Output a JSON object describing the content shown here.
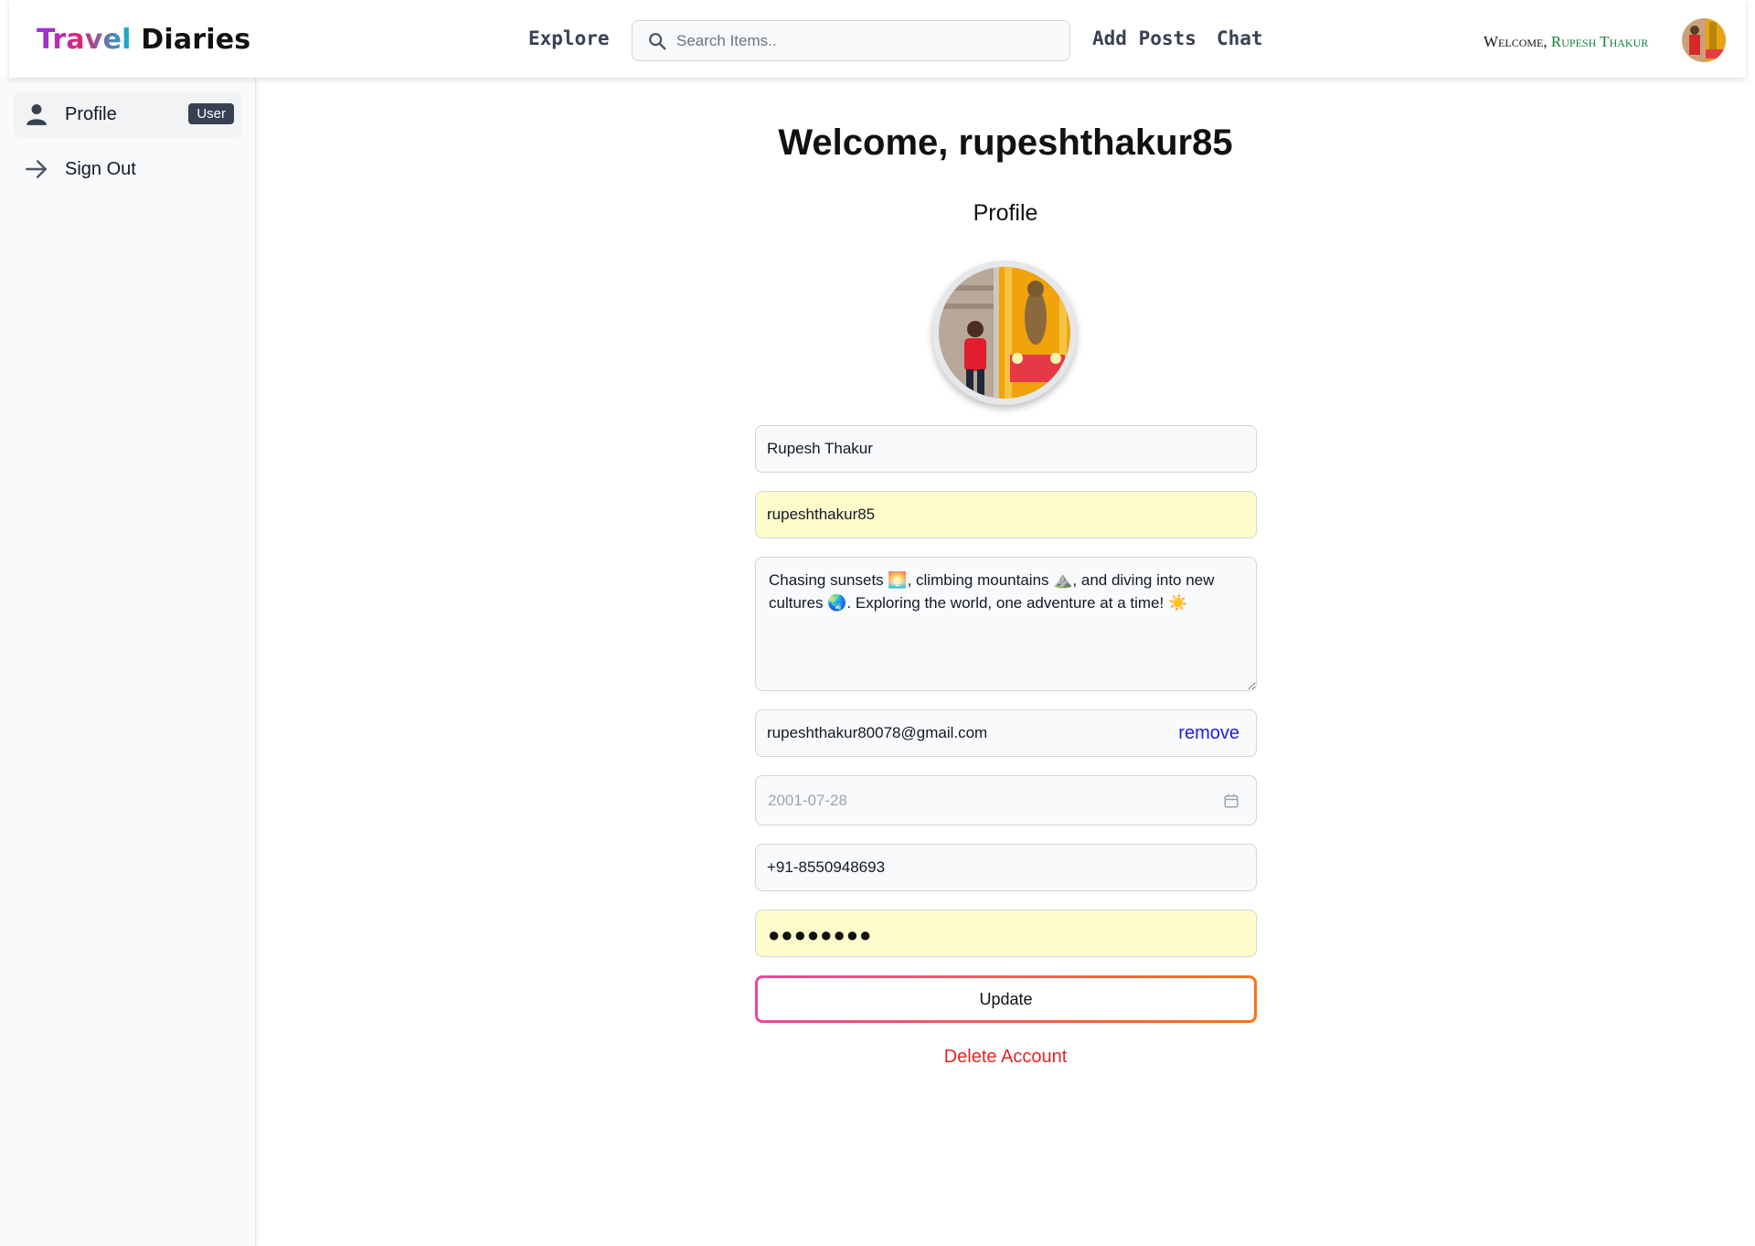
{
  "header": {
    "logo_part1": "Travel",
    "logo_part2": "Diaries",
    "nav_explore": "Explore",
    "search_placeholder": "Search Items..",
    "nav_add_posts": "Add Posts",
    "nav_chat": "Chat",
    "welcome_prefix": "Welcome,",
    "welcome_name": "Rupesh Thakur"
  },
  "sidebar": {
    "items": [
      {
        "label": "Profile",
        "badge": "User",
        "icon": "user-icon"
      },
      {
        "label": "Sign Out",
        "icon": "arrow-right-icon"
      }
    ]
  },
  "main": {
    "title": "Welcome, rupeshthakur85",
    "subtitle": "Profile",
    "fields": {
      "full_name": "Rupesh Thakur",
      "username": "rupeshthakur85",
      "bio": "Chasing sunsets 🌅, climbing mountains ⛰️, and diving into new cultures 🌏. Exploring the world, one adventure at a time! ☀️",
      "email": "rupeshthakur80078@gmail.com",
      "email_action": "remove",
      "dob": "2001-07-28",
      "phone": "+91-8550948693",
      "password_mask": "●●●●●●●●"
    },
    "update_label": "Update",
    "delete_label": "Delete Account"
  },
  "colors": {
    "accent_gradient_start": "#ec4899",
    "accent_gradient_end": "#f97316",
    "delete": "#dc2626",
    "autofill_bg": "#fefccb",
    "welcome_name": "#15803d"
  }
}
